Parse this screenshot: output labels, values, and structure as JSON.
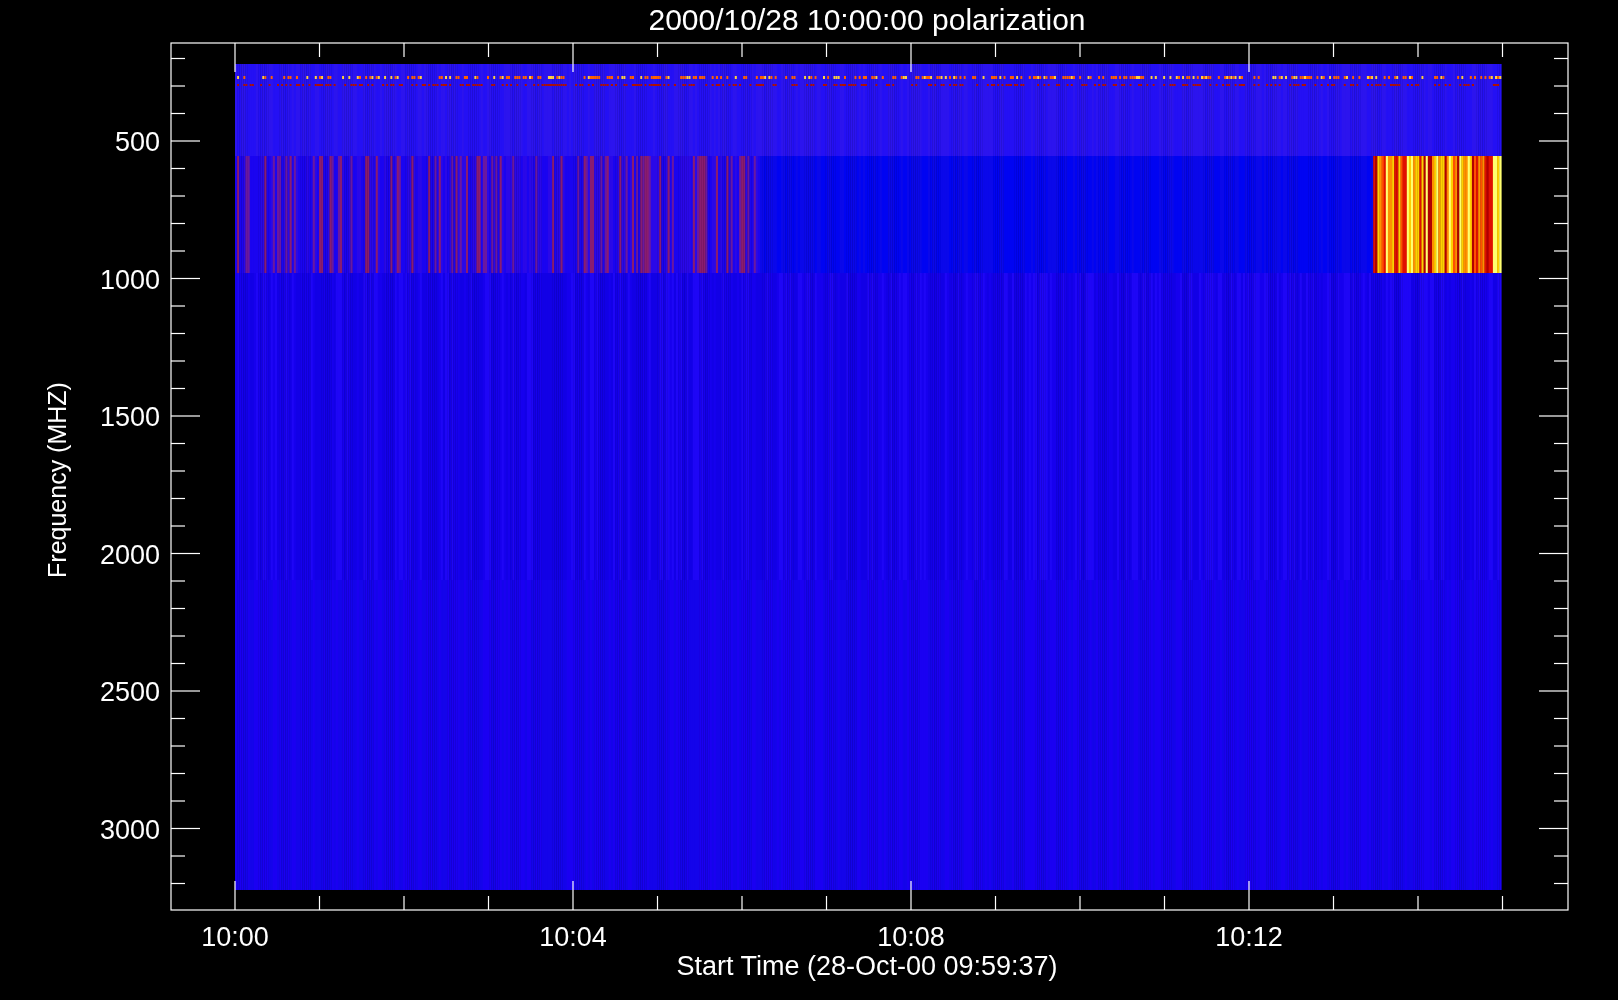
{
  "title": "2000/10/28 10:00:00 polarization",
  "y_axis": {
    "label": "Frequency (MHZ)",
    "ticks": [
      "500",
      "1000",
      "1500",
      "2000",
      "2500",
      "3000"
    ]
  },
  "x_axis": {
    "label": "Start Time (28-Oct-00 09:59:37)",
    "ticks": [
      "10:00",
      "10:04",
      "10:08",
      "10:12"
    ]
  }
}
